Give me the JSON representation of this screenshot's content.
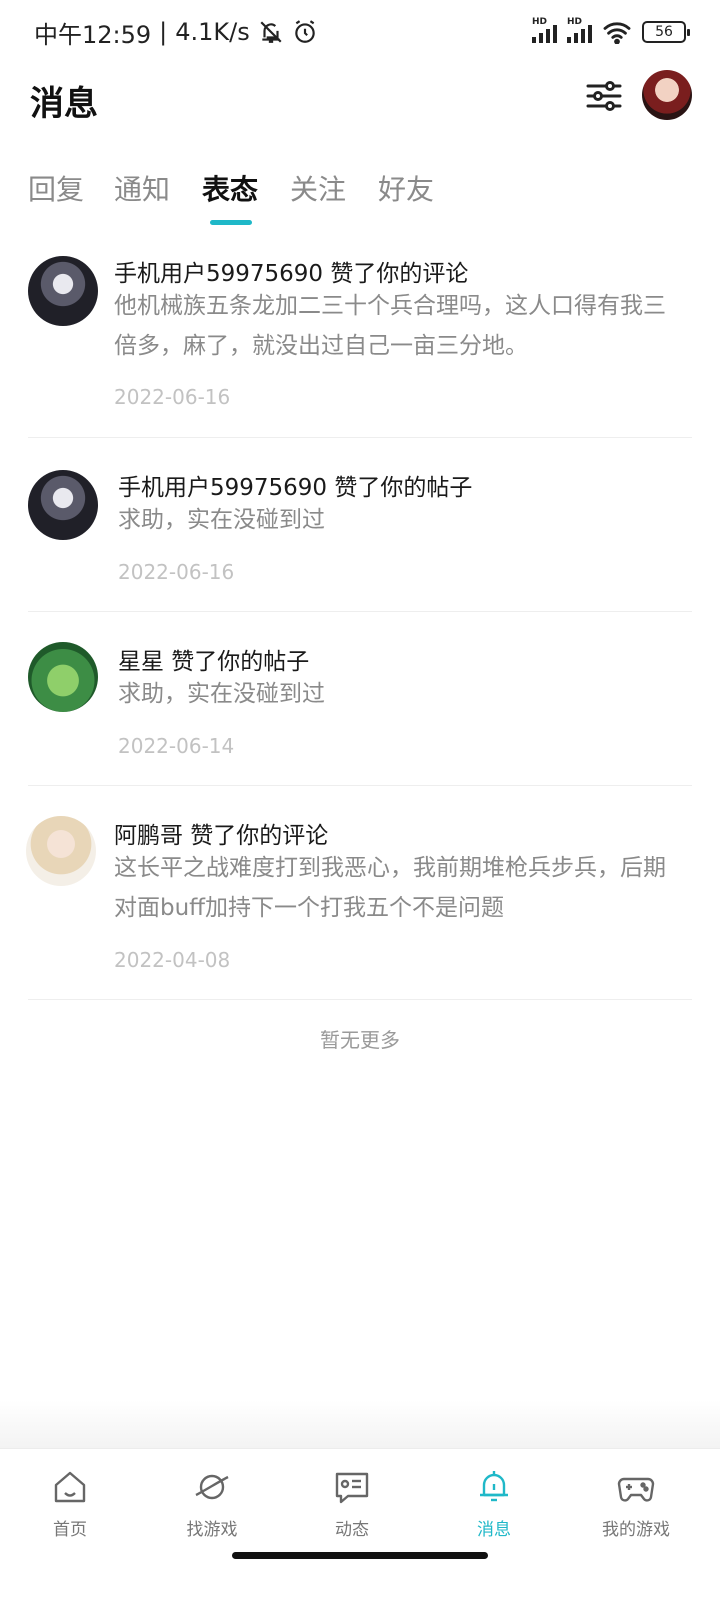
{
  "status_bar": {
    "time": "中午12:59",
    "net_speed": "4.1K/s",
    "battery": "56",
    "hd_label": "HD"
  },
  "header": {
    "title": "消息"
  },
  "tabs": [
    {
      "label": "回复"
    },
    {
      "label": "通知"
    },
    {
      "label": "表态"
    },
    {
      "label": "关注"
    },
    {
      "label": "好友"
    }
  ],
  "active_tab": "表态",
  "items": [
    {
      "title": "手机用户59975690 赞了你的评论",
      "content": "他机械族五条龙加二三十个兵合理吗，这人口得有我三倍多，麻了，就没出过自己一亩三分地。",
      "date": "2022-06-16"
    },
    {
      "title": "手机用户59975690 赞了你的帖子",
      "content": "求助，实在没碰到过",
      "date": "2022-06-16"
    },
    {
      "title": "星星 赞了你的帖子",
      "content": "求助，实在没碰到过",
      "date": "2022-06-14"
    },
    {
      "title": "阿鹏哥 赞了你的评论",
      "content": "这长平之战难度打到我恶心，我前期堆枪兵步兵，后期对面buff加持下一个打我五个不是问题",
      "date": "2022-04-08"
    }
  ],
  "no_more": "暂无更多",
  "bottom_nav": [
    {
      "label": "首页",
      "icon": "home-icon"
    },
    {
      "label": "找游戏",
      "icon": "planet-icon"
    },
    {
      "label": "动态",
      "icon": "feed-icon"
    },
    {
      "label": "消息",
      "icon": "bell-icon"
    },
    {
      "label": "我的游戏",
      "icon": "gamepad-icon"
    }
  ],
  "colors": {
    "accent": "#1fb8c8",
    "text_primary": "#1a1a1a",
    "text_secondary": "#8a8a8a",
    "text_date": "#c2c2c2"
  }
}
